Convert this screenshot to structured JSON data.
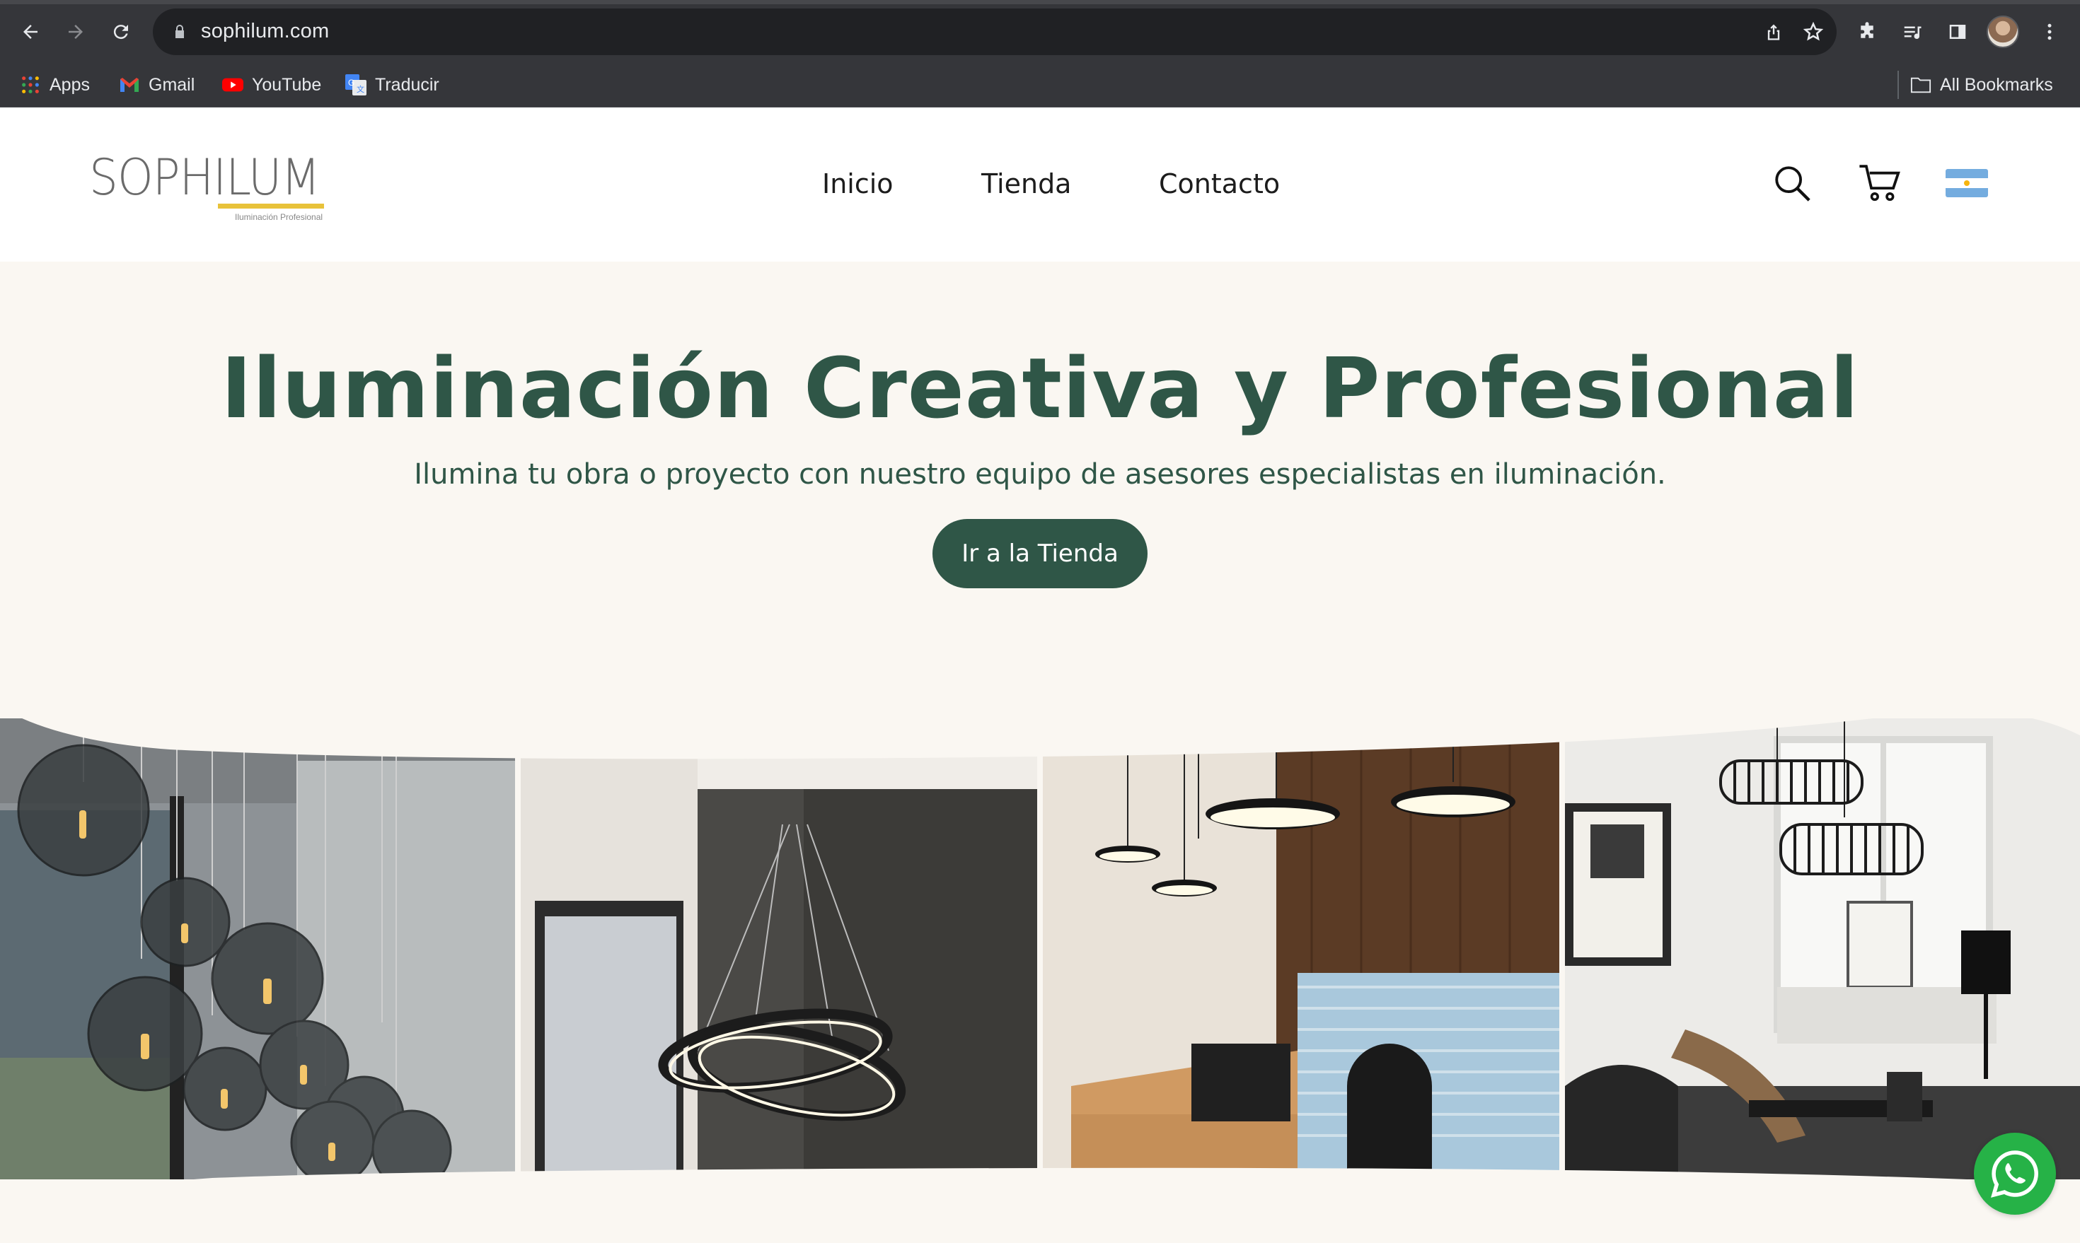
{
  "browser": {
    "url": "sophilum.com",
    "bookmarks": [
      {
        "label": "Apps",
        "icon": "apps-grid-icon"
      },
      {
        "label": "Gmail",
        "icon": "gmail-icon"
      },
      {
        "label": "YouTube",
        "icon": "youtube-icon"
      },
      {
        "label": "Traducir",
        "icon": "google-translate-icon"
      }
    ],
    "all_bookmarks": "All Bookmarks"
  },
  "site": {
    "logo": {
      "word": "SOPHILUM",
      "tagline": "Iluminación Profesional"
    },
    "menu": [
      "Inicio",
      "Tienda",
      "Contacto"
    ],
    "hero": {
      "title": "Iluminación Creativa y Profesional",
      "subtitle": "Ilumina tu obra o proyecto con nuestro equipo de asesores especialistas en iluminación.",
      "cta": "Ir a la Tienda"
    }
  },
  "colors": {
    "brand_green": "#2f5647",
    "background": "#faf7f2",
    "logo_accent": "#e8c23a",
    "whatsapp": "#26b247"
  }
}
